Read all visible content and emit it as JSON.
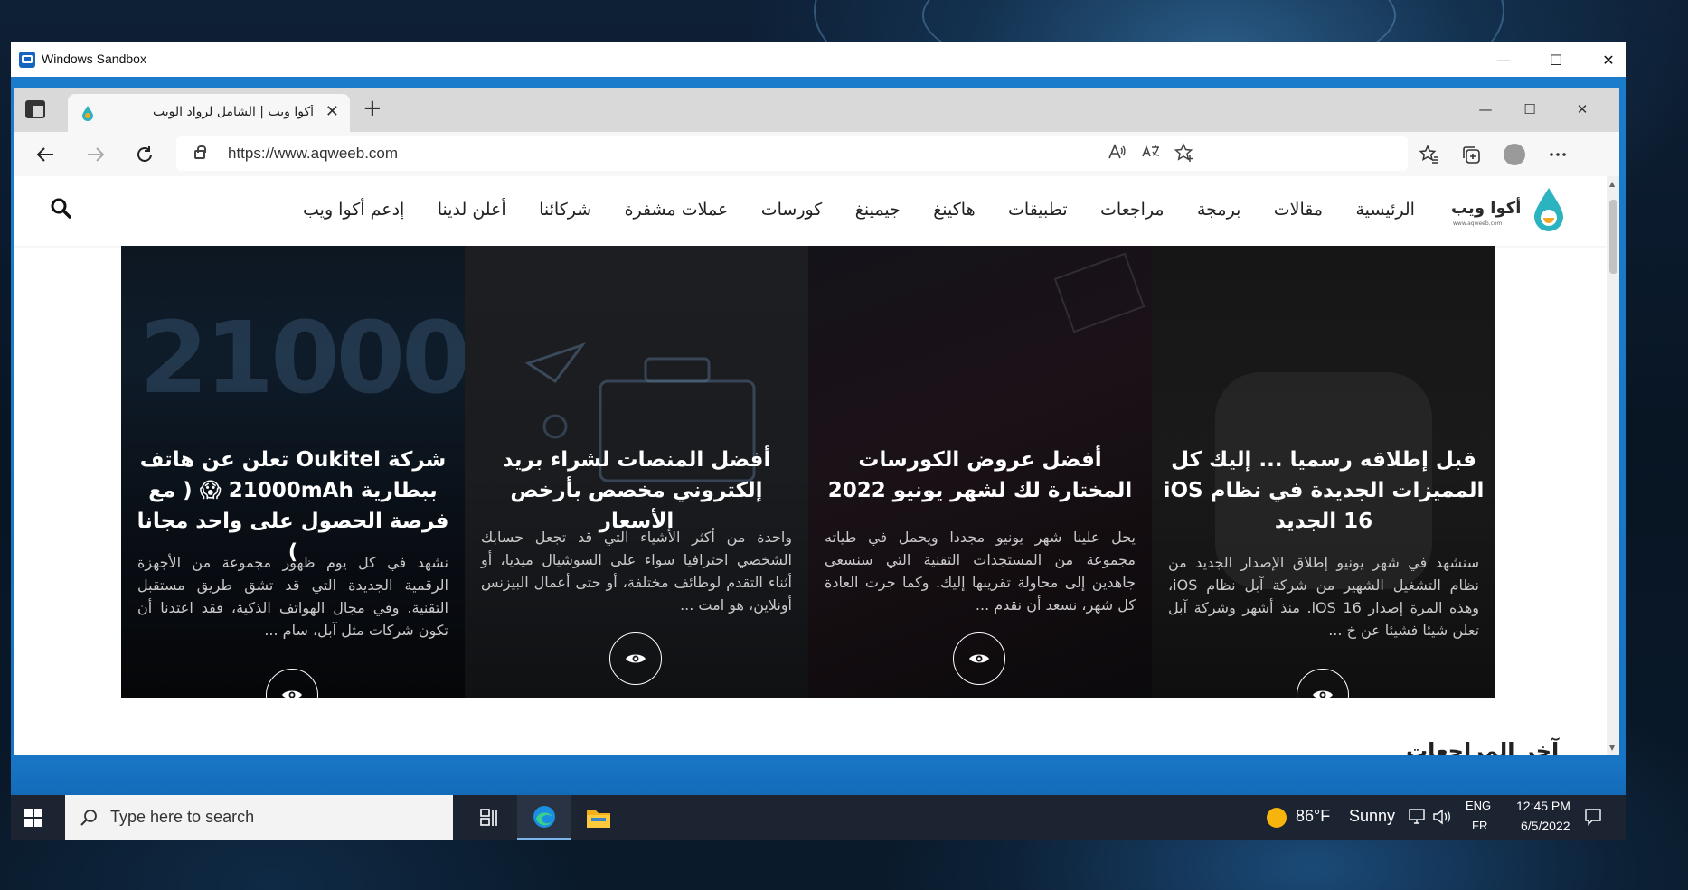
{
  "sandbox": {
    "title": "Windows Sandbox",
    "controls": {
      "minimize": "—",
      "maximize": "☐",
      "close": "✕"
    }
  },
  "browser": {
    "tab": {
      "title": "أكوا ويب | الشامل لرواد الويب",
      "close": "✕"
    },
    "new_tab": "+",
    "window_controls": {
      "minimize": "—",
      "maximize": "☐",
      "close": "✕"
    },
    "url": "https://www.aqweeb.com",
    "icons": [
      "back-icon",
      "forward-icon",
      "refresh-icon",
      "lock-icon",
      "read-aloud-icon",
      "translate-icon",
      "add-favorite-icon",
      "favorites-icon",
      "collections-icon",
      "profile-icon",
      "more-icon"
    ]
  },
  "site": {
    "logo": {
      "name": "أكوا ويب",
      "sub": "www.aqweeb.com"
    },
    "menu": [
      "الرئيسية",
      "مقالات",
      "برمجة",
      "مراجعات",
      "تطبيقات",
      "هاكينغ",
      "جيمينغ",
      "كورسات",
      "عملات مشفرة",
      "شركائنا",
      "أعلن لدينا",
      "إدعم أكوا ويب"
    ],
    "cards": [
      {
        "title": "شركة Oukitel تعلن عن هاتف ببطارية 21000mAh 😱 ( مع فرصة الحصول على واحد مجانا )",
        "excerpt": "نشهد في كل يوم ظهور مجموعة من الأجهزة الرقمية الجديدة التي قد تشق طريق مستقبل التقنية. وفي مجال الهواتف الذكية، فقد اعتدنا أن تكون شركات مثل آبل، سام ...",
        "bg_label": "21000"
      },
      {
        "title": "أفضل المنصات لشراء بريد إلكتروني مخصص بأرخص الأسعار",
        "excerpt": "واحدة من أكثر الأشياء التي قد تجعل حسابك الشخصي احترافيا سواء على السوشيال ميديا، أو أثناء التقدم لوظائف مختلفة، أو حتى أعمال البيزنس أونلاين، هو امت ..."
      },
      {
        "title": "أفضل عروض الكورسات المختارة لك لشهر يونيو 2022",
        "excerpt": "يحل علينا شهر يونيو مجددا ويحمل في طياته مجموعة من المستجدات التقنية التي سنسعى جاهدين إلى محاولة تقريبها إليك. وكما جرت العادة كل شهر، نسعد أن نقدم ..."
      },
      {
        "title": "قبل إطلاقه رسميا ... إليك كل المميزات الجديدة في نظام iOS 16 الجديد",
        "excerpt": "سنشهد في شهر يونيو إطلاق الإصدار الجديد من نظام التشغيل الشهير من شركة آبل نظام iOS، وهذه المرة إصدار iOS 16. منذ أشهر وشركة آبل تعلن شيئا فشيئا عن خ ..."
      }
    ],
    "bottom_heading": "آخر المراجعات"
  },
  "taskbar": {
    "search_placeholder": "Type here to search",
    "weather": {
      "temp": "86°F",
      "condition": "Sunny"
    },
    "lang": {
      "top": "ENG",
      "bottom": "FR"
    },
    "clock": {
      "time": "12:45 PM",
      "date": "6/5/2022"
    }
  },
  "colors": {
    "accent": "#1a78c8",
    "taskbar": "#1c2331",
    "card_bg": "#141414"
  }
}
